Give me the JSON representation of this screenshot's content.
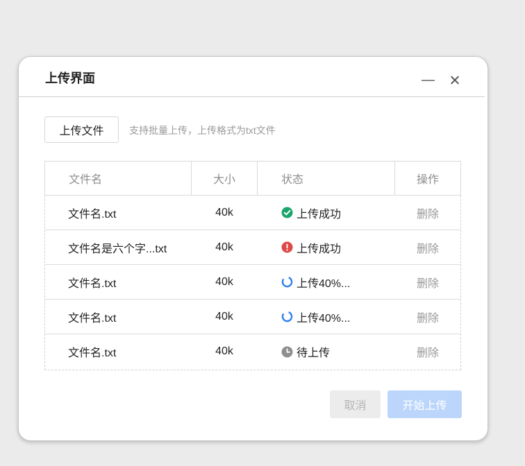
{
  "dialog": {
    "title": "上传界面",
    "minimize_icon": "minimize-icon",
    "close_icon": "close-icon"
  },
  "toolbar": {
    "upload_button": "上传文件",
    "hint": "支持批量上传，上传格式为txt文件"
  },
  "table": {
    "columns": [
      "文件名",
      "大小",
      "状态",
      "操作"
    ],
    "rows": [
      {
        "name": "文件名.txt",
        "size": "40k",
        "status_icon": "success-check-icon",
        "status": "上传成功",
        "action": "删除"
      },
      {
        "name": "文件名是六个字...txt",
        "size": "40k",
        "status_icon": "error-exclamation-icon",
        "status": "上传成功",
        "action": "删除"
      },
      {
        "name": "文件名.txt",
        "size": "40k",
        "status_icon": "loading-spinner-icon",
        "status": "上传40%...",
        "action": "删除"
      },
      {
        "name": "文件名.txt",
        "size": "40k",
        "status_icon": "loading-spinner-icon",
        "status": "上传40%...",
        "action": "删除"
      },
      {
        "name": "文件名.txt",
        "size": "40k",
        "status_icon": "clock-pending-icon",
        "status": "待上传",
        "action": "删除"
      }
    ]
  },
  "footer": {
    "cancel_button": "取消",
    "start_button": "开始上传"
  },
  "colors": {
    "success": "#1aa56b",
    "error": "#e04848",
    "loading": "#2f80ed",
    "pending": "#8f8f8f",
    "primary_disabled": "#bcd6fb"
  }
}
